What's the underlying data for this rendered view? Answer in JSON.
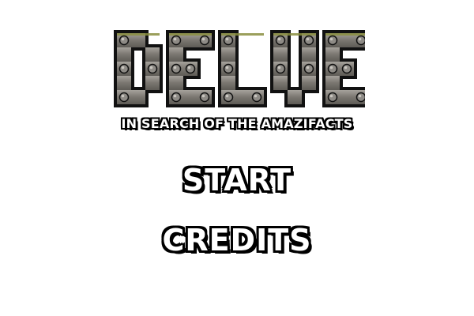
{
  "title": {
    "letters": [
      "D",
      "E",
      "L",
      "V",
      "E"
    ],
    "text": "DELVE",
    "plate_color": "#7a7670",
    "plate_highlight": "#a6a39c",
    "trim_color": "#8a8e40",
    "outline_color": "#111111",
    "rivet_color": "#8e8b86"
  },
  "subtitle": "IN SEARCH OF THE AMAZIFACTS",
  "menu": {
    "start_label": "START",
    "credits_label": "CREDITS"
  }
}
